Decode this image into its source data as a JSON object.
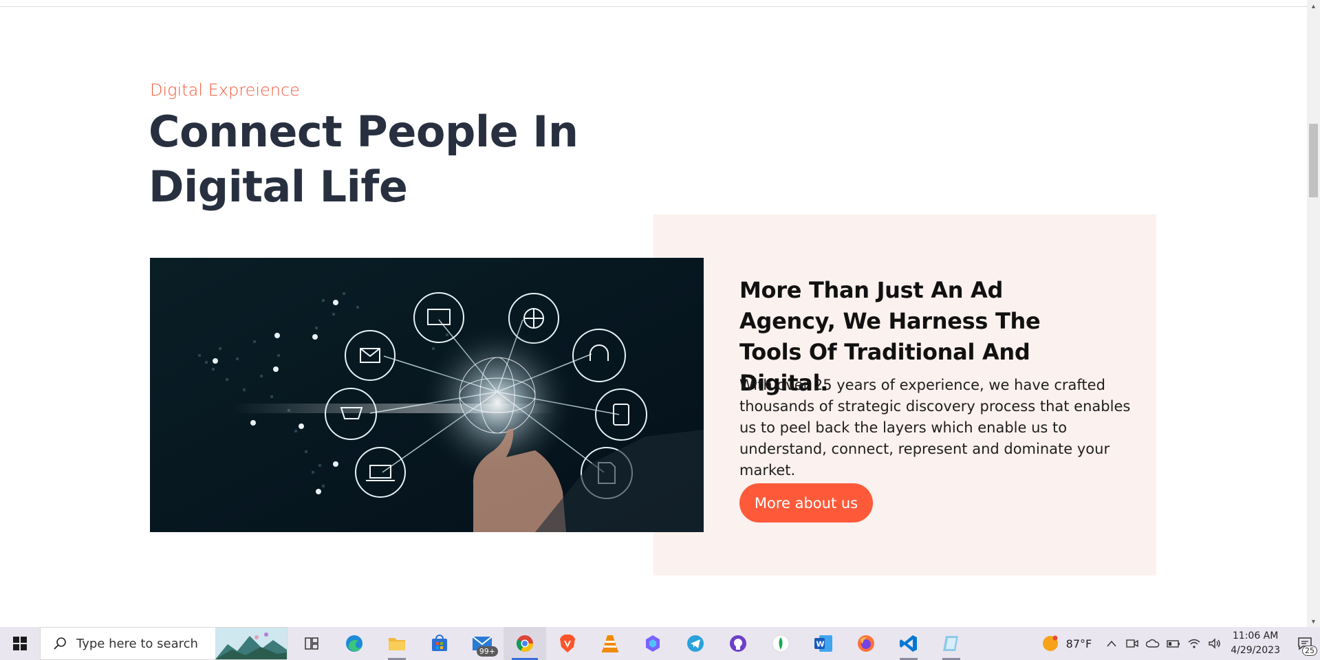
{
  "section": {
    "eyebrow": "Digital Expreience",
    "headline": "Connect People In Digital Life"
  },
  "panel": {
    "title": "More Than Just An Ad Agency, We Harness The Tools Of Traditional And Digital.",
    "text": "With over 25 years of experience, we have crafted thousands of strategic discovery process that enables us to peel back the layers which enable us to understand, connect, represent and dominate your market.",
    "cta_label": "More about us"
  },
  "colors": {
    "accent": "#fe5a3a",
    "headline": "#283040",
    "panel_bg": "#fbf1ee"
  },
  "taskbar": {
    "search_placeholder": "Type here to search",
    "pinned": [
      {
        "name": "task-view-icon"
      },
      {
        "name": "edge-icon"
      },
      {
        "name": "file-explorer-icon"
      },
      {
        "name": "microsoft-store-icon"
      },
      {
        "name": "mail-icon",
        "badge": "99+"
      },
      {
        "name": "chrome-icon"
      },
      {
        "name": "brave-icon"
      },
      {
        "name": "vlc-icon"
      },
      {
        "name": "copilot-icon"
      },
      {
        "name": "telegram-icon"
      },
      {
        "name": "github-desktop-icon"
      },
      {
        "name": "mongodb-compass-icon"
      },
      {
        "name": "word-icon"
      },
      {
        "name": "firefox-icon"
      },
      {
        "name": "vscode-icon"
      },
      {
        "name": "app-icon"
      }
    ],
    "weather_temp": "87°F",
    "time": "11:06 AM",
    "date": "4/29/2023",
    "notification_count": "25"
  }
}
